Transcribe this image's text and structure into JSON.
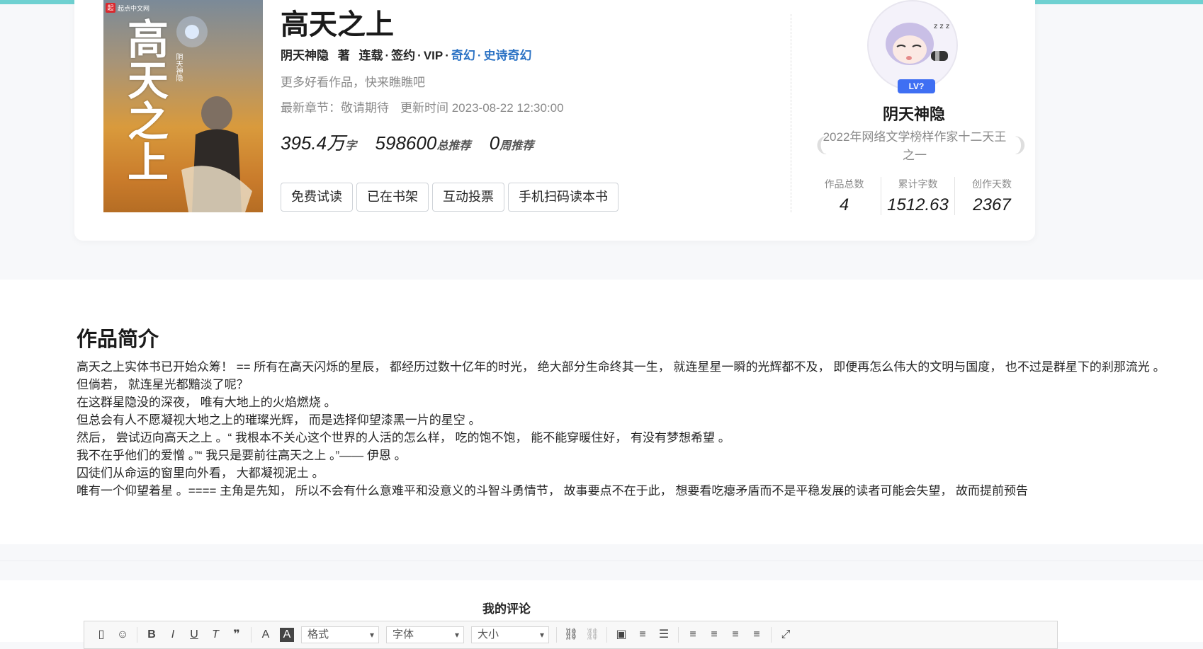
{
  "book": {
    "title": "高天之上",
    "author": "阴天神隐",
    "author_suffix": "著",
    "status": "连载",
    "contract": "签约",
    "vip": "VIP",
    "category": "奇幻",
    "subcategory": "史诗奇幻",
    "slogan": "更多好看作品，快来瞧瞧吧",
    "latest_label": "最新章节：敬请期待",
    "update_label": "更新时间 2023-08-22 12:30:00",
    "word_count": "395.4万",
    "word_unit": "字",
    "total_rec": "598600",
    "total_rec_unit": "总推荐",
    "week_rec": "0",
    "week_rec_unit": "周推荐",
    "cover": {
      "publisher": "起点中文网",
      "title_art": "高天之上",
      "author_art": "阴天神隐"
    }
  },
  "actions": [
    "免费试读",
    "已在书架",
    "互动投票",
    "手机扫码读本书"
  ],
  "author": {
    "level_badge": "LV?",
    "name": "阴天神隐",
    "honor": "2022年网络文学榜样作家十二天王之一",
    "stats": [
      {
        "label": "作品总数",
        "value": "4"
      },
      {
        "label": "累计字数",
        "value": "1512.63"
      },
      {
        "label": "创作天数",
        "value": "2367"
      }
    ]
  },
  "intro": {
    "title": "作品简介",
    "lines": [
      "高天之上实体书已开始众筹！ == 所有在高天闪烁的星辰， 都经历过数十亿年的时光， 绝大部分生命终其一生， 就连星星一瞬的光辉都不及， 即便再怎么伟大的文明与国度， 也不过是群星下的刹那流光 。",
      "但倘若， 就连星光都黯淡了呢？",
      "在这群星隐没的深夜， 唯有大地上的火焰燃烧 。",
      "但总会有人不愿凝视大地之上的璀璨光辉， 而是选择仰望漆黑一片的星空 。",
      "然后， 尝试迈向高天之上 。“ 我根本不关心这个世界的人活的怎么样， 吃的饱不饱， 能不能穿暖住好， 有没有梦想希望 。",
      "我不在乎他们的爱憎 。”“ 我只是要前往高天之上 。”—— 伊恩 。",
      "囚徒们从命运的窗里向外看， 大都凝视泥土 。",
      "唯有一个仰望着星 。==== 主角是先知， 所以不会有什么意难平和没意义的斗智斗勇情节， 故事要点不在于此， 想要看吃瘪矛盾而不是平稳发展的读者可能会失望， 故而提前预告"
    ]
  },
  "comment": {
    "title": "我的评论",
    "format_select": "格式",
    "font_select": "字体",
    "size_select": "大小"
  },
  "colors": {
    "accent_link": "#2b72c4",
    "top_bar": "#6fd1d1",
    "level_badge": "#3f6ff3"
  }
}
